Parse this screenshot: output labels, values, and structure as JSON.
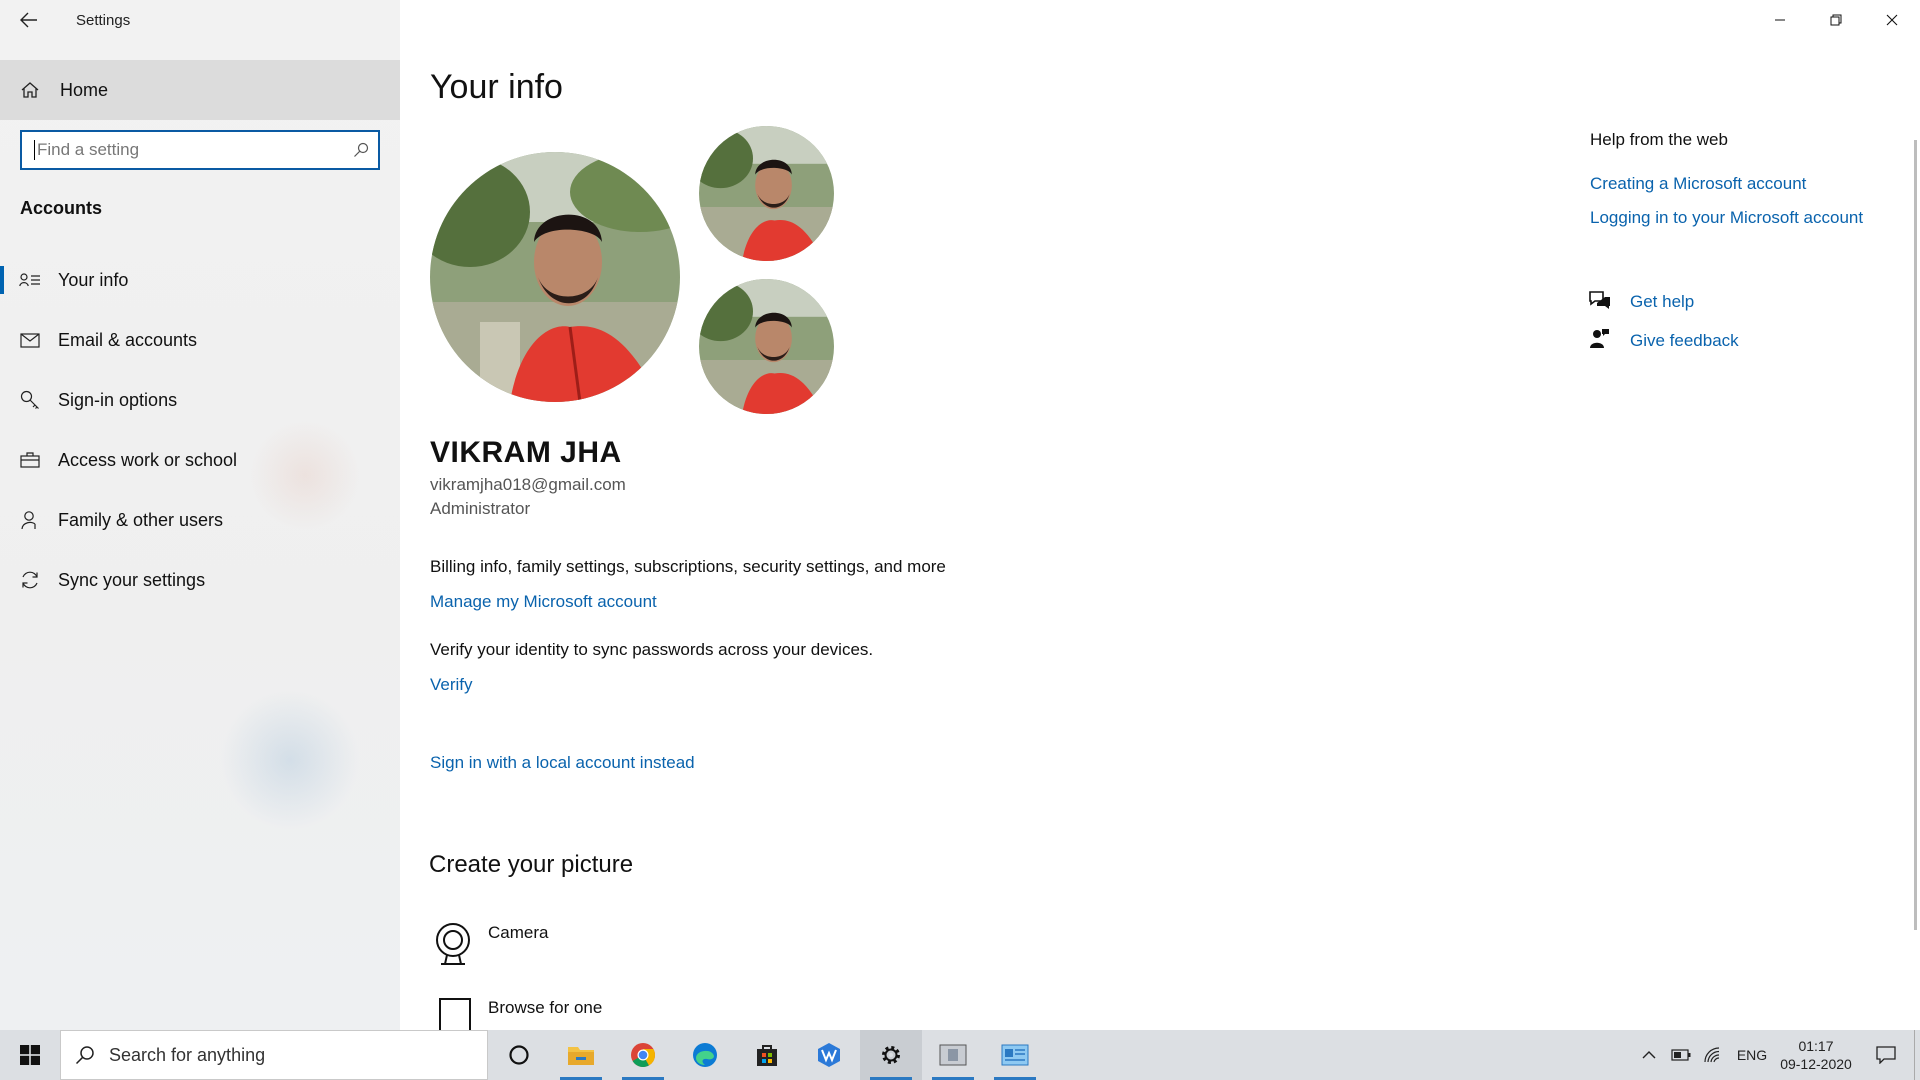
{
  "window": {
    "title": "Settings"
  },
  "sidebar": {
    "home_label": "Home",
    "search_placeholder": "Find a setting",
    "section_title": "Accounts",
    "items": [
      {
        "label": "Your info",
        "icon": "person-card-icon",
        "active": true
      },
      {
        "label": "Email & accounts",
        "icon": "mail-icon",
        "active": false
      },
      {
        "label": "Sign-in options",
        "icon": "key-icon",
        "active": false
      },
      {
        "label": "Access work or school",
        "icon": "briefcase-icon",
        "active": false
      },
      {
        "label": "Family & other users",
        "icon": "person-add-icon",
        "active": false
      },
      {
        "label": "Sync your settings",
        "icon": "sync-icon",
        "active": false
      }
    ]
  },
  "main": {
    "title": "Your info",
    "user": {
      "name": "VIKRAM JHA",
      "email": "vikramjha018@gmail.com",
      "role": "Administrator"
    },
    "billing_text": "Billing info, family settings, subscriptions, security settings, and more",
    "manage_link": "Manage my Microsoft account",
    "verify_text": "Verify your identity to sync passwords across your devices.",
    "verify_link": "Verify",
    "local_link": "Sign in with a local account instead",
    "create_title": "Create your picture",
    "camera_label": "Camera",
    "browse_label": "Browse for one"
  },
  "help": {
    "title": "Help from the web",
    "links": [
      "Creating a Microsoft account",
      "Logging in to your Microsoft account"
    ],
    "get_help": "Get help",
    "give_feedback": "Give feedback"
  },
  "taskbar": {
    "search_text": "Search for anything",
    "language": "ENG",
    "time": "01:17",
    "date": "09-12-2020"
  },
  "colors": {
    "accent": "#0063b1",
    "link": "#0a63ad",
    "sidebar_bg": "#f2f2f2",
    "taskbar_bg": "#dcdfe3"
  }
}
